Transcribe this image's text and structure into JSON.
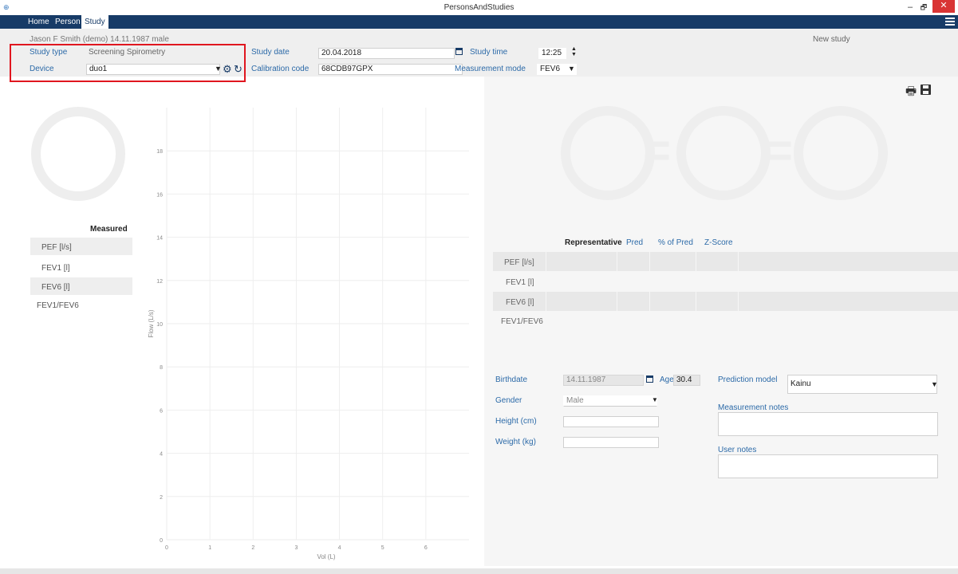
{
  "window": {
    "title": "PersonsAndStudies",
    "minimize": "–",
    "restore": "🗗",
    "close": "✕"
  },
  "nav": {
    "tabs": [
      {
        "label": "Home"
      },
      {
        "label": "Person"
      },
      {
        "label": "Study"
      }
    ]
  },
  "header": {
    "person_info": "Jason F Smith (demo) 14.11.1987 male",
    "new_study": "New study",
    "study_type_label": "Study type",
    "study_type_value": "Screening Spirometry",
    "device_label": "Device",
    "device_value": "duo1",
    "study_date_label": "Study date",
    "study_date_value": "20.04.2018",
    "calibration_label": "Calibration code",
    "calibration_value": "68CDB97GPX",
    "study_time_label": "Study time",
    "study_time_value": "12:25",
    "measurement_mode_label": "Measurement mode",
    "measurement_mode_value": "FEV6"
  },
  "summary": {
    "header": "Measured",
    "rows": [
      "PEF [l/s]",
      "FEV1 [l]",
      "FEV6 [l]",
      "FEV1/FEV6"
    ]
  },
  "chart_data": {
    "type": "line",
    "xlabel": "Vol (L)",
    "ylabel": "Flow (L/s)",
    "xlim": [
      0,
      7
    ],
    "ylim": [
      0,
      20
    ],
    "x_ticks": [
      "0",
      "1",
      "2",
      "3",
      "4",
      "5",
      "6"
    ],
    "y_ticks": [
      "0",
      "2",
      "4",
      "6",
      "8",
      "10",
      "12",
      "14",
      "16",
      "18"
    ],
    "grid": true,
    "series": []
  },
  "results": {
    "headers": {
      "representative": "Representative",
      "pred": "Pred",
      "pct_pred": "% of Pred",
      "zscore": "Z-Score"
    },
    "rows": [
      "PEF [l/s]",
      "FEV1 [l]",
      "FEV6 [l]",
      "FEV1/FEV6"
    ],
    "ring_separator": "="
  },
  "person_form": {
    "birthdate_label": "Birthdate",
    "birthdate_value": "14.11.1987",
    "age_label": "Age",
    "age_value": "30.4",
    "gender_label": "Gender",
    "gender_value": "Male",
    "height_label": "Height (cm)",
    "weight_label": "Weight (kg)",
    "prediction_model_label": "Prediction model",
    "prediction_model_value": "Kainu",
    "measurement_notes_label": "Measurement notes",
    "user_notes_label": "User notes"
  },
  "colors": {
    "nav_bg": "#173b67",
    "label_blue": "#2c6aa8",
    "highlight": "#e0161f",
    "close_btn": "#d93434"
  },
  "icons": {
    "print": "print-icon",
    "save": "save-icon",
    "calendar": "calendar-icon",
    "gear": "gear-icon",
    "reset": "reset-icon",
    "menu": "hamburger-menu-icon"
  }
}
